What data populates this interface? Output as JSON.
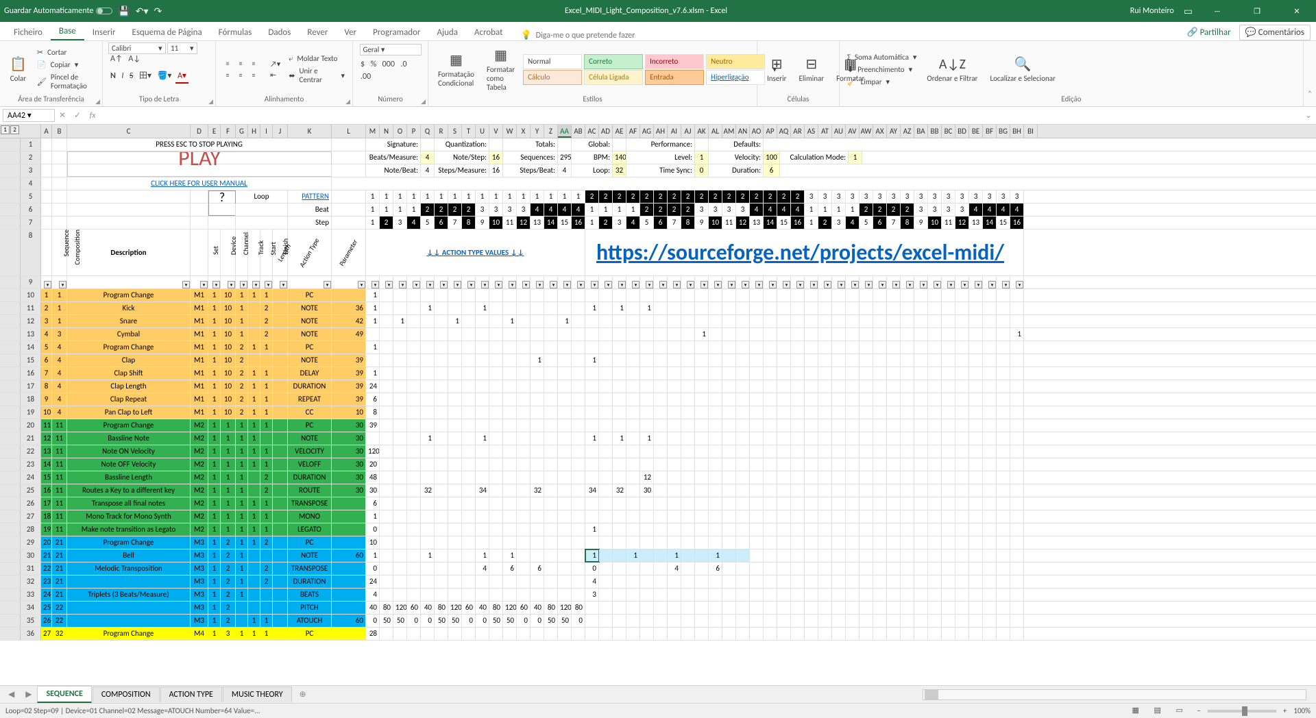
{
  "titlebar": {
    "autosave": "Guardar Automaticamente",
    "filename": "Excel_MIDI_Light_Composition_v7.6.xlsm - Excel",
    "user": "Rui Monteiro"
  },
  "tabs": {
    "ficheiro": "Ficheiro",
    "base": "Base",
    "inserir": "Inserir",
    "esquema": "Esquema de Página",
    "formulas": "Fórmulas",
    "dados": "Dados",
    "rever": "Rever",
    "ver": "Ver",
    "programador": "Programador",
    "ajuda": "Ajuda",
    "acrobat": "Acrobat",
    "tellme": "Diga-me o que pretende fazer",
    "partilhar": "Partilhar",
    "comentarios": "Comentários"
  },
  "ribbon": {
    "clip_cortar": "Cortar",
    "clip_copiar": "Copiar",
    "clip_pincel": "Pincel de Formatação",
    "g_clip": "Área de Transferência",
    "font_name": "Calibri",
    "font_size": "11",
    "g_font": "Tipo de Letra",
    "moldar": "Moldar Texto",
    "unir": "Unir e Centrar",
    "g_align": "Alinhamento",
    "num_fmt": "Geral",
    "g_num": "Número",
    "fmt_cond": "Formatação Condicional",
    "fmt_tab": "Formatar como Tabela",
    "s_normal": "Normal",
    "s_correto": "Correto",
    "s_incorreto": "Incorreto",
    "s_neutro": "Neutro",
    "s_calculo": "Cálculo",
    "s_celula": "Célula Ligada",
    "s_entrada": "Entrada",
    "s_hiper": "Hiperligação",
    "g_styles": "Estilos",
    "inserir_btn": "Inserir",
    "eliminar_btn": "Eliminar",
    "formatar_btn": "Formatar",
    "g_cells": "Células",
    "soma": "Soma Automática",
    "preench": "Preenchimento",
    "limpar": "Limpar",
    "ordenar": "Ordenar e Filtrar",
    "localizar": "Localizar e Selecionar",
    "g_edit": "Edição"
  },
  "fb": {
    "namebox": "AA42",
    "formula": ""
  },
  "colheads": [
    "A",
    "B",
    "C",
    "D",
    "E",
    "F",
    "G",
    "H",
    "I",
    "J",
    "K",
    "L",
    "M",
    "N",
    "O",
    "P",
    "Q",
    "R",
    "S",
    "T",
    "U",
    "V",
    "W",
    "X",
    "Y",
    "Z",
    "AA",
    "AB",
    "AC",
    "AD",
    "AE",
    "AF",
    "AG",
    "AH",
    "AI",
    "AJ",
    "AK",
    "AL",
    "AM",
    "AN",
    "AO",
    "AP",
    "AQ",
    "AR",
    "AS",
    "AT",
    "AU",
    "AV",
    "AW",
    "AX",
    "AY",
    "AZ",
    "BA",
    "BB",
    "BC",
    "BD",
    "BE",
    "BF",
    "BG",
    "BH",
    "BI"
  ],
  "colsel": "AA",
  "header": {
    "esc": "PRESS ESC TO STOP PLAYING",
    "play": "PLAY",
    "manual": "CLICK HERE FOR USER MANUAL",
    "loop": "Loop",
    "help": "?",
    "sig": "Signature:",
    "quant": "Quantization:",
    "totals": "Totals:",
    "global": "Global:",
    "perf": "Performance:",
    "defaults": "Defaults:",
    "beatsM": "Beats/Measure:",
    "beatsMV": "4",
    "noteStep": "Note/Step:",
    "noteStepV": "16",
    "sequences": "Sequences:",
    "sequencesV": "295",
    "bpm": "BPM:",
    "bpmV": "140",
    "level": "Level:",
    "levelV": "1",
    "velocity": "Velocity:",
    "velocityV": "100",
    "calcMode": "Calculation Mode:",
    "calcModeV": "1",
    "noteBeat": "Note/Beat:",
    "noteBeatV": "4",
    "stepsM": "Steps/Measure:",
    "stepsMV": "16",
    "stepsB": "Steps/Beat:",
    "stepsBV": "4",
    "loopH": "Loop:",
    "loopHV": "32",
    "timeSync": "Time Sync:",
    "timeSyncV": "0",
    "duration": "Duration:",
    "durationV": "6",
    "pattern": "PATTERN",
    "beat": "Beat",
    "step": "Step",
    "actValues": "↓↓ ACTION TYPE VALUES ↓↓",
    "url": "https://sourceforge.net/projects/excel-midi/",
    "patternRow": [
      "1",
      "1",
      "1",
      "1",
      "1",
      "1",
      "1",
      "1",
      "1",
      "1",
      "1",
      "1",
      "1",
      "1",
      "1",
      "1",
      "2",
      "2",
      "2",
      "2",
      "2",
      "2",
      "2",
      "2",
      "2",
      "2",
      "2",
      "2",
      "2",
      "2",
      "2",
      "2",
      "3",
      "3",
      "3",
      "3",
      "3",
      "3",
      "3",
      "3",
      "3",
      "3",
      "3",
      "3",
      "3",
      "3",
      "3",
      "3"
    ],
    "beatRow": [
      "1",
      "1",
      "1",
      "1",
      "2",
      "2",
      "2",
      "2",
      "3",
      "3",
      "3",
      "3",
      "4",
      "4",
      "4",
      "4",
      "1",
      "1",
      "1",
      "1",
      "2",
      "2",
      "2",
      "2",
      "3",
      "3",
      "3",
      "3",
      "4",
      "4",
      "4",
      "4",
      "1",
      "1",
      "1",
      "1",
      "2",
      "2",
      "2",
      "2",
      "3",
      "3",
      "3",
      "3",
      "4",
      "4",
      "4",
      "4"
    ],
    "stepRow": [
      "1",
      "2",
      "3",
      "4",
      "5",
      "6",
      "7",
      "8",
      "9",
      "10",
      "11",
      "12",
      "13",
      "14",
      "15",
      "16",
      "1",
      "2",
      "3",
      "4",
      "5",
      "6",
      "7",
      "8",
      "9",
      "10",
      "11",
      "12",
      "13",
      "14",
      "15",
      "16",
      "1",
      "2",
      "3",
      "4",
      "5",
      "6",
      "7",
      "8",
      "9",
      "10",
      "11",
      "12",
      "13",
      "14",
      "15",
      "16"
    ]
  },
  "colLabels": {
    "seq": "Sequence",
    "comp": "Composition",
    "desc": "Description",
    "set": "Set",
    "device": "Device",
    "channel": "Channel",
    "track": "Track",
    "start": "Start",
    "finish": "Finish",
    "length": "Length",
    "actionType": "Action Type",
    "parameter": "Parameter"
  },
  "rows": [
    {
      "rn": 10,
      "a": 1,
      "b": 1,
      "d": "Program Change",
      "set": "M1",
      "dev": 1,
      "ch": 10,
      "tr": 1,
      "st": "",
      "fi": "",
      "len": 1,
      "ln": 1,
      "at": "PC",
      "p": "",
      "l": 1,
      "cls": "orange",
      "steps": {
        "0": "1"
      }
    },
    {
      "rn": 11,
      "a": 2,
      "b": 1,
      "d": "Kick",
      "set": "M1",
      "dev": 1,
      "ch": 10,
      "tr": 1,
      "st": "",
      "fi": "",
      "len": "",
      "ln": 2,
      "at": "NOTE",
      "p": 36,
      "l": 1,
      "cls": "orange",
      "steps": {
        "0": "1",
        "4": "1",
        "8": "1",
        "16": "1",
        "18": "1",
        "20": "1"
      }
    },
    {
      "rn": 12,
      "a": 3,
      "b": 1,
      "d": "Snare",
      "set": "M1",
      "dev": 1,
      "ch": 10,
      "tr": 1,
      "st": "",
      "fi": "",
      "len": "",
      "ln": 2,
      "at": "NOTE",
      "p": 42,
      "l": 1,
      "cls": "orange",
      "steps": {
        "2": "1",
        "6": "1",
        "10": "1",
        "14": "1"
      }
    },
    {
      "rn": 13,
      "a": 4,
      "b": 3,
      "d": "Cymbal",
      "set": "M1",
      "dev": 1,
      "ch": 10,
      "tr": 1,
      "st": "",
      "fi": "",
      "len": "",
      "ln": 2,
      "at": "NOTE",
      "p": 49,
      "l": "",
      "cls": "orange",
      "steps": {
        "24": "1",
        "47": "1"
      }
    },
    {
      "rn": 14,
      "a": 5,
      "b": 4,
      "d": "Program Change",
      "set": "M1",
      "dev": 1,
      "ch": 10,
      "tr": 2,
      "st": "",
      "fi": "",
      "len": 1,
      "ln": 1,
      "at": "PC",
      "p": "",
      "l": 1,
      "cls": "orange",
      "steps": {
        "0": "1"
      }
    },
    {
      "rn": 15,
      "a": 6,
      "b": 4,
      "d": "Clap",
      "set": "M1",
      "dev": 1,
      "ch": 10,
      "tr": 2,
      "st": "",
      "fi": "",
      "len": "",
      "ln": "",
      "at": "NOTE",
      "p": 39,
      "l": "",
      "cls": "orange",
      "steps": {
        "12": "1",
        "16": "1"
      }
    },
    {
      "rn": 16,
      "a": 7,
      "b": 4,
      "d": "Clap Shift",
      "set": "M1",
      "dev": 1,
      "ch": 10,
      "tr": 2,
      "st": "",
      "fi": "",
      "len": 1,
      "ln": 1,
      "at": "DELAY",
      "p": 39,
      "l": 1,
      "cls": "orange",
      "steps": {
        "0": "1"
      }
    },
    {
      "rn": 17,
      "a": 8,
      "b": 4,
      "d": "Clap Length",
      "set": "M1",
      "dev": 1,
      "ch": 10,
      "tr": 2,
      "st": "",
      "fi": "",
      "len": 1,
      "ln": 1,
      "at": "DURATION",
      "p": 39,
      "l": 24,
      "cls": "orange",
      "steps": {}
    },
    {
      "rn": 18,
      "a": 9,
      "b": 4,
      "d": "Clap Repeat",
      "set": "M1",
      "dev": 1,
      "ch": 10,
      "tr": 2,
      "st": "",
      "fi": "",
      "len": 1,
      "ln": 1,
      "at": "REPEAT",
      "p": 39,
      "l": 6,
      "cls": "orange",
      "steps": {}
    },
    {
      "rn": 19,
      "a": 10,
      "b": 4,
      "d": "Pan Clap to Left",
      "set": "M1",
      "dev": 1,
      "ch": 10,
      "tr": 2,
      "st": "",
      "fi": "",
      "len": 1,
      "ln": 1,
      "at": "CC",
      "p": 10,
      "l": 8,
      "cls": "orange",
      "steps": {}
    },
    {
      "rn": 20,
      "a": 11,
      "b": 11,
      "d": "Program Change",
      "set": "M2",
      "dev": 1,
      "ch": 1,
      "tr": 1,
      "st": "",
      "fi": "",
      "len": 1,
      "ln": 1,
      "at": "PC",
      "p": 30,
      "l": 39,
      "cls": "green",
      "steps": {}
    },
    {
      "rn": 21,
      "a": 12,
      "b": 11,
      "d": "Bassline Note",
      "set": "M2",
      "dev": 1,
      "ch": 1,
      "tr": 1,
      "st": "",
      "fi": "",
      "len": 1,
      "ln": "",
      "at": "NOTE",
      "p": 30,
      "l": "",
      "cls": "green",
      "steps": {
        "4": "1",
        "8": "1",
        "16": "1",
        "18": "1",
        "20": "1"
      }
    },
    {
      "rn": 22,
      "a": 13,
      "b": 11,
      "d": "Note ON Velocity",
      "set": "M2",
      "dev": 1,
      "ch": 1,
      "tr": 1,
      "st": "",
      "fi": "",
      "len": 1,
      "ln": 1,
      "at": "VELOCITY",
      "p": 30,
      "l": 120,
      "cls": "green",
      "steps": {}
    },
    {
      "rn": 23,
      "a": 14,
      "b": 11,
      "d": "Note OFF Velocity",
      "set": "M2",
      "dev": 1,
      "ch": 1,
      "tr": 1,
      "st": "",
      "fi": "",
      "len": 1,
      "ln": 1,
      "at": "VELOFF",
      "p": 30,
      "l": 20,
      "cls": "green",
      "steps": {}
    },
    {
      "rn": 24,
      "a": 15,
      "b": 11,
      "d": "Bassline Length",
      "set": "M2",
      "dev": 1,
      "ch": 1,
      "tr": 1,
      "st": "",
      "fi": "",
      "len": "",
      "ln": 2,
      "at": "DURATION",
      "p": 30,
      "l": 48,
      "cls": "green",
      "steps": {
        "20": "12"
      }
    },
    {
      "rn": 25,
      "a": 16,
      "b": 11,
      "d": "Routes a Key to a different key",
      "set": "M2",
      "dev": 1,
      "ch": 1,
      "tr": 1,
      "st": "",
      "fi": "",
      "len": "",
      "ln": 2,
      "at": "ROUTE",
      "p": 30,
      "l": 30,
      "cls": "green",
      "steps": {
        "4": "32",
        "8": "34",
        "12": "32",
        "16": "34",
        "18": "32",
        "20": "30"
      }
    },
    {
      "rn": 26,
      "a": 17,
      "b": 11,
      "d": "Transpose all final notes",
      "set": "M2",
      "dev": 1,
      "ch": 1,
      "tr": 1,
      "st": "",
      "fi": "",
      "len": 1,
      "ln": 1,
      "at": "TRANSPOSE",
      "p": "",
      "l": 6,
      "cls": "green",
      "steps": {}
    },
    {
      "rn": 27,
      "a": 18,
      "b": 11,
      "d": "Mono Track for Mono Synth",
      "set": "M2",
      "dev": 1,
      "ch": 1,
      "tr": 1,
      "st": "",
      "fi": "",
      "len": 1,
      "ln": 1,
      "at": "MONO",
      "p": "",
      "l": 1,
      "cls": "green",
      "steps": {}
    },
    {
      "rn": 28,
      "a": 19,
      "b": 11,
      "d": "Make note transition as Legato",
      "set": "M2",
      "dev": 1,
      "ch": 1,
      "tr": 1,
      "st": "",
      "fi": "",
      "len": 1,
      "ln": 1,
      "at": "LEGATO",
      "p": "",
      "l": 0,
      "cls": "green",
      "steps": {
        "16": "1"
      }
    },
    {
      "rn": 29,
      "a": 20,
      "b": 21,
      "d": "Program Change",
      "set": "M3",
      "dev": 1,
      "ch": 2,
      "tr": 1,
      "st": "",
      "fi": "",
      "len": 1,
      "ln": 2,
      "at": "PC",
      "p": "",
      "l": 10,
      "cls": "blue",
      "steps": {}
    },
    {
      "rn": 30,
      "a": 21,
      "b": 21,
      "d": "Bell",
      "set": "M3",
      "dev": 1,
      "ch": 2,
      "tr": 1,
      "st": "",
      "fi": "",
      "len": "",
      "ln": "",
      "at": "NOTE",
      "p": 60,
      "l": 1,
      "cls": "blue",
      "steps": {
        "4": "1",
        "8": "1",
        "10": "1",
        "16": "1",
        "19": "1",
        "22": "1",
        "25": "1"
      },
      "sel": true
    },
    {
      "rn": 31,
      "a": 22,
      "b": 21,
      "d": "Melodic Transposition",
      "set": "M3",
      "dev": 1,
      "ch": 2,
      "tr": 1,
      "st": "",
      "fi": "",
      "len": "",
      "ln": 2,
      "at": "TRANSPOSE",
      "p": "",
      "l": 0,
      "cls": "blue",
      "steps": {
        "8": "4",
        "10": "6",
        "12": "6",
        "16": "0",
        "22": "4",
        "25": "6"
      }
    },
    {
      "rn": 32,
      "a": 23,
      "b": 21,
      "d": "",
      "set": "M3",
      "dev": 1,
      "ch": 2,
      "tr": 1,
      "st": "",
      "fi": "",
      "len": "",
      "ln": 2,
      "at": "DURATION",
      "p": "",
      "l": 24,
      "cls": "blue",
      "steps": {
        "16": "4"
      }
    },
    {
      "rn": 33,
      "a": 24,
      "b": 21,
      "d": "Triplets (3 Beats/Measure)",
      "set": "M3",
      "dev": 1,
      "ch": 2,
      "tr": 1,
      "st": "",
      "fi": "",
      "len": "",
      "ln": "",
      "at": "BEATS",
      "p": "",
      "l": 4,
      "cls": "blue",
      "steps": {
        "16": "3"
      }
    },
    {
      "rn": 34,
      "a": 25,
      "b": 22,
      "d": "",
      "set": "M3",
      "dev": 1,
      "ch": 2,
      "tr": "",
      "st": "",
      "fi": "",
      "len": "",
      "ln": "",
      "at": "PITCH",
      "p": "",
      "l": 40,
      "cls": "blue",
      "steps": {
        "0": "40",
        "1": "80",
        "2": "120",
        "3": "60",
        "4": "40",
        "5": "80",
        "6": "120",
        "7": "60",
        "8": "40",
        "9": "80",
        "10": "120",
        "11": "60",
        "12": "40",
        "13": "80",
        "14": "120",
        "15": "80"
      }
    },
    {
      "rn": 35,
      "a": 26,
      "b": 22,
      "d": "",
      "set": "M3",
      "dev": 1,
      "ch": 2,
      "tr": "",
      "st": "",
      "fi": "",
      "len": 1,
      "ln": 1,
      "at": "ATOUCH",
      "p": 60,
      "l": 0,
      "cls": "blue",
      "steps": {
        "0": "0",
        "1": "50",
        "2": "50",
        "3": "0",
        "4": "0",
        "5": "50",
        "6": "50",
        "7": "0",
        "8": "0",
        "9": "50",
        "10": "50",
        "11": "0",
        "12": "0",
        "13": "50",
        "14": "50",
        "15": "0"
      }
    },
    {
      "rn": 36,
      "a": 27,
      "b": 32,
      "d": "Program Change",
      "set": "M4",
      "dev": 1,
      "ch": 3,
      "tr": 1,
      "st": "",
      "fi": "",
      "len": 1,
      "ln": 1,
      "at": "PC",
      "p": "",
      "l": 28,
      "cls": "yellow",
      "steps": {}
    }
  ],
  "sheets": {
    "s1": "SEQUENCE",
    "s2": "COMPOSITION",
    "s3": "ACTION TYPE",
    "s4": "MUSIC THEORY"
  },
  "status": {
    "left": "Loop=02 Step=09 | Device=01 Channel=02 Message=ATOUCH Number=64 Value=...",
    "zoom": "100%"
  },
  "chart_data": null
}
